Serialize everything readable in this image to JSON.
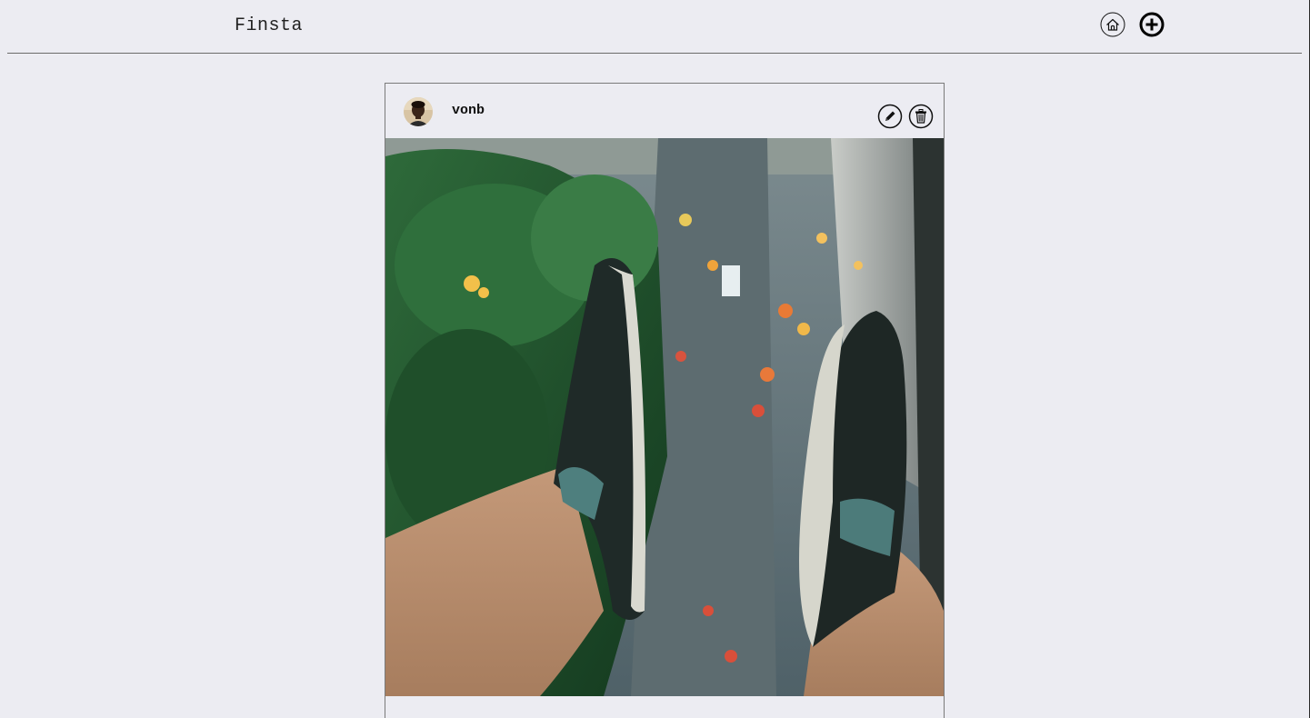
{
  "app": {
    "brand": "Finsta",
    "nav": {
      "home_icon": "home-icon",
      "add_icon": "plus-circle-icon"
    }
  },
  "post": {
    "username": "vonb",
    "avatar_icon": "avatar",
    "actions": {
      "edit_icon": "pencil-icon",
      "delete_icon": "trash-icon"
    },
    "image_subject": "photo"
  },
  "colors": {
    "background": "#ececf2",
    "text": "#111111",
    "border": "#7a7a7a"
  }
}
